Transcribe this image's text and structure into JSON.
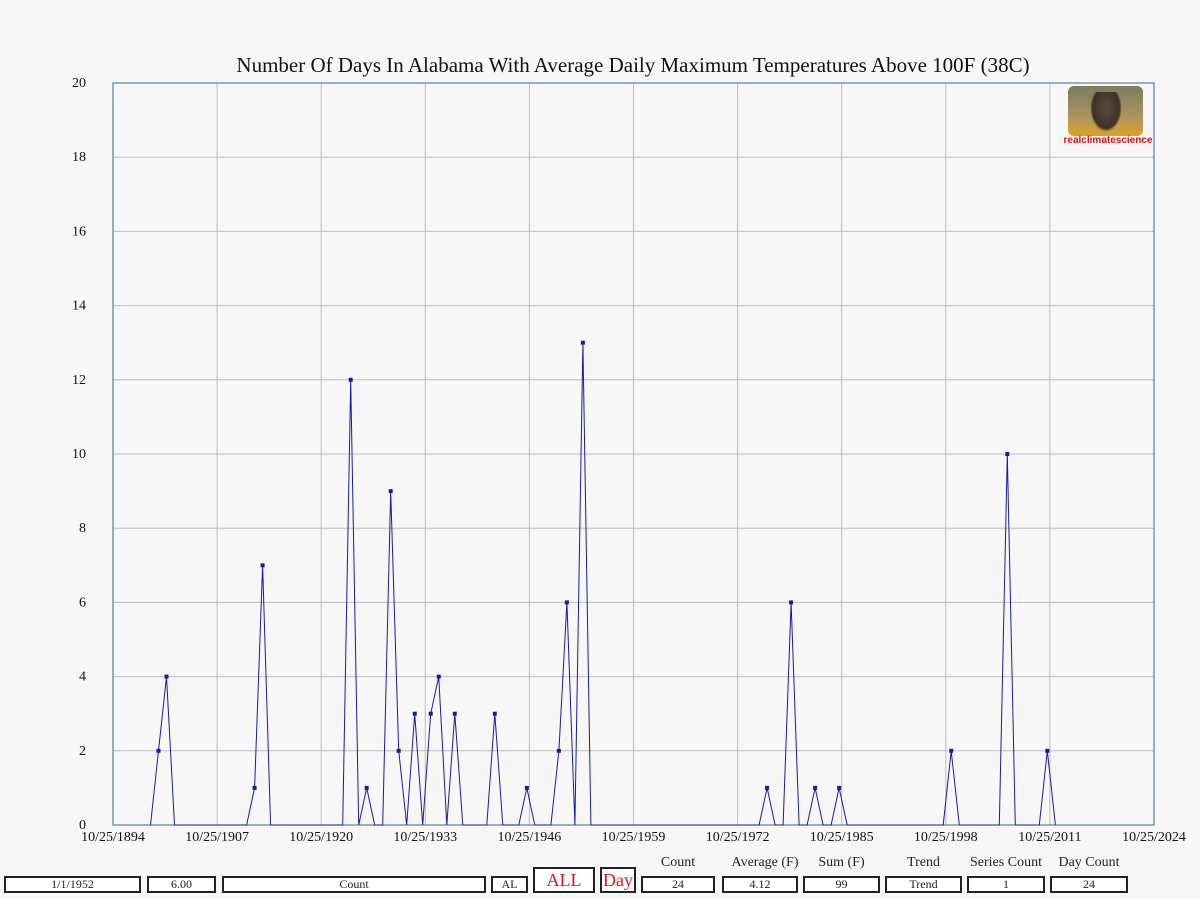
{
  "chart_data": {
    "type": "line",
    "title": "Number Of Days In Alabama With Average Daily Maximum Temperatures Above 100F (38C)",
    "xlabel": "",
    "ylabel": "",
    "ylim": [
      0,
      20
    ],
    "xlim": [
      "1894-10-25",
      "2024-10-25"
    ],
    "x_tick_labels": [
      "10/25/1894",
      "10/25/1907",
      "10/25/1920",
      "10/25/1933",
      "10/25/1946",
      "10/25/1959",
      "10/25/1972",
      "10/25/1985",
      "10/25/1998",
      "10/25/2011",
      "10/25/2024"
    ],
    "y_ticks": [
      0,
      2,
      4,
      6,
      8,
      10,
      12,
      14,
      16,
      18,
      20
    ],
    "grid": true,
    "series": [
      {
        "color": "#1a1aa0",
        "points": [
          {
            "x": "1899-07-01",
            "y": 0
          },
          {
            "x": "1900-07-01",
            "y": 2,
            "marker": true
          },
          {
            "x": "1901-07-01",
            "y": 4,
            "marker": true
          },
          {
            "x": "1902-07-01",
            "y": 0
          },
          {
            "x": "1911-07-01",
            "y": 0
          },
          {
            "x": "1912-07-01",
            "y": 1,
            "marker": true
          },
          {
            "x": "1913-07-01",
            "y": 7,
            "marker": true
          },
          {
            "x": "1914-07-01",
            "y": 0
          },
          {
            "x": "1923-07-01",
            "y": 0
          },
          {
            "x": "1924-07-01",
            "y": 12,
            "marker": true
          },
          {
            "x": "1925-07-01",
            "y": 0
          },
          {
            "x": "1926-07-01",
            "y": 1,
            "marker": true
          },
          {
            "x": "1927-07-01",
            "y": 0
          },
          {
            "x": "1928-07-01",
            "y": 0
          },
          {
            "x": "1929-07-01",
            "y": 9,
            "marker": true
          },
          {
            "x": "1930-07-01",
            "y": 2,
            "marker": true
          },
          {
            "x": "1931-07-01",
            "y": 0
          },
          {
            "x": "1932-07-01",
            "y": 3,
            "marker": true
          },
          {
            "x": "1933-07-01",
            "y": 0
          },
          {
            "x": "1934-07-01",
            "y": 3,
            "marker": true
          },
          {
            "x": "1935-07-01",
            "y": 4,
            "marker": true
          },
          {
            "x": "1936-07-01",
            "y": 0
          },
          {
            "x": "1937-07-01",
            "y": 3,
            "marker": true
          },
          {
            "x": "1938-07-01",
            "y": 0
          },
          {
            "x": "1941-07-01",
            "y": 0
          },
          {
            "x": "1942-07-01",
            "y": 3,
            "marker": true
          },
          {
            "x": "1943-07-01",
            "y": 0
          },
          {
            "x": "1945-07-01",
            "y": 0
          },
          {
            "x": "1946-07-01",
            "y": 1,
            "marker": true
          },
          {
            "x": "1947-07-01",
            "y": 0
          },
          {
            "x": "1949-07-01",
            "y": 0
          },
          {
            "x": "1950-07-01",
            "y": 2,
            "marker": true
          },
          {
            "x": "1951-07-01",
            "y": 6,
            "marker": true
          },
          {
            "x": "1952-07-01",
            "y": 0
          },
          {
            "x": "1953-07-01",
            "y": 13,
            "marker": true
          },
          {
            "x": "1954-07-01",
            "y": 0
          },
          {
            "x": "1975-07-01",
            "y": 0
          },
          {
            "x": "1976-07-01",
            "y": 1,
            "marker": true
          },
          {
            "x": "1977-07-01",
            "y": 0
          },
          {
            "x": "1978-07-01",
            "y": 0
          },
          {
            "x": "1979-07-01",
            "y": 6,
            "marker": true
          },
          {
            "x": "1980-07-01",
            "y": 0
          },
          {
            "x": "1981-07-01",
            "y": 0
          },
          {
            "x": "1982-07-01",
            "y": 1,
            "marker": true
          },
          {
            "x": "1983-07-01",
            "y": 0
          },
          {
            "x": "1984-07-01",
            "y": 0
          },
          {
            "x": "1985-07-01",
            "y": 1,
            "marker": true
          },
          {
            "x": "1986-07-01",
            "y": 0
          },
          {
            "x": "1998-07-01",
            "y": 0
          },
          {
            "x": "1999-07-01",
            "y": 2,
            "marker": true
          },
          {
            "x": "2000-07-01",
            "y": 0
          },
          {
            "x": "2005-07-01",
            "y": 0
          },
          {
            "x": "2006-07-01",
            "y": 10,
            "marker": true
          },
          {
            "x": "2007-07-01",
            "y": 0
          },
          {
            "x": "2010-07-01",
            "y": 0
          },
          {
            "x": "2011-07-01",
            "y": 2,
            "marker": true
          },
          {
            "x": "2012-07-01",
            "y": 0
          }
        ]
      }
    ]
  },
  "logo": {
    "text": "realclimatescience"
  },
  "controls": {
    "date": "1/1/1952",
    "value": "6.00",
    "mode": "Count",
    "state": "AL",
    "all": "ALL",
    "day": "Day"
  },
  "stats": {
    "count_label": "Count",
    "count_value": "24",
    "average_label": "Average (F)",
    "average_value": "4.12",
    "sum_label": "Sum (F)",
    "sum_value": "99",
    "trend_label": "Trend",
    "trend_value": "Trend",
    "series_count_label": "Series Count",
    "series_count_value": "1",
    "day_count_label": "Day Count",
    "day_count_value": "24"
  }
}
